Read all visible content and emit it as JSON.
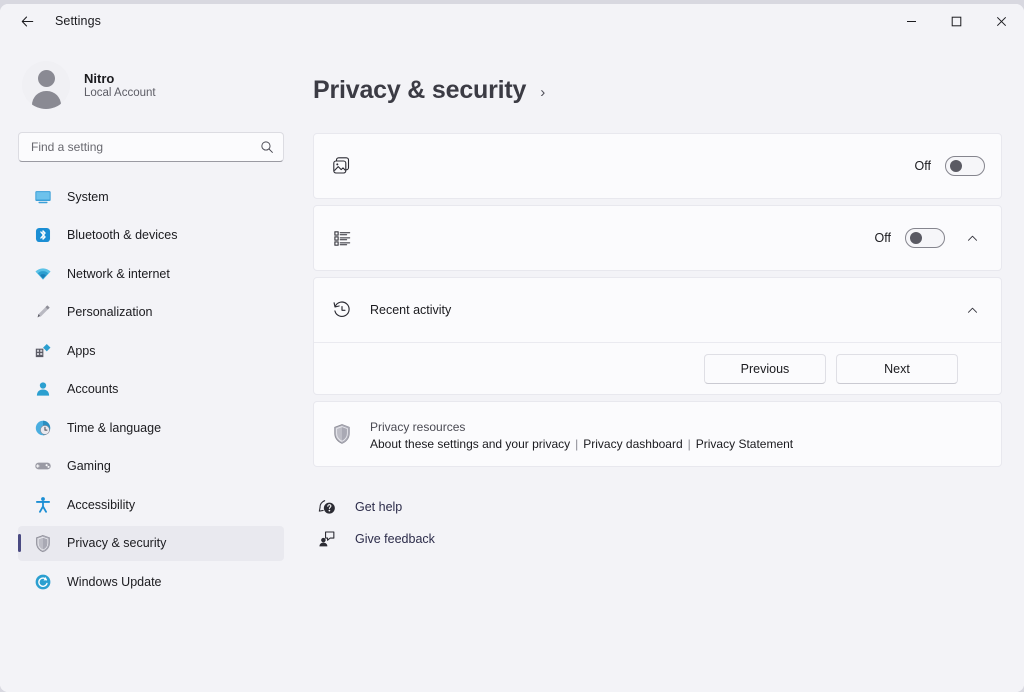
{
  "window": {
    "app_title": "Settings",
    "back_icon": "back-arrow-icon",
    "controls": {
      "minimize": "–",
      "maximize": "□",
      "close": "✕"
    }
  },
  "sidebar": {
    "profile": {
      "name": "Nitro",
      "account_type": "Local Account",
      "avatar_icon": "person-avatar-icon"
    },
    "search": {
      "placeholder": "Find a setting",
      "value": "",
      "icon": "search-icon"
    },
    "items": [
      {
        "label": "System",
        "icon": "system-icon",
        "selected": false
      },
      {
        "label": "Bluetooth & devices",
        "icon": "bluetooth-icon",
        "selected": false
      },
      {
        "label": "Network & internet",
        "icon": "network-wifi-icon",
        "selected": false
      },
      {
        "label": "Personalization",
        "icon": "paintbrush-icon",
        "selected": false
      },
      {
        "label": "Apps",
        "icon": "apps-icon",
        "selected": false
      },
      {
        "label": "Accounts",
        "icon": "accounts-icon",
        "selected": false
      },
      {
        "label": "Time & language",
        "icon": "clock-globe-icon",
        "selected": false
      },
      {
        "label": "Gaming",
        "icon": "gamepad-icon",
        "selected": false
      },
      {
        "label": "Accessibility",
        "icon": "accessibility-icon",
        "selected": false
      },
      {
        "label": "Privacy & security",
        "icon": "shield-icon",
        "selected": true
      },
      {
        "label": "Windows Update",
        "icon": "update-refresh-icon",
        "selected": false
      }
    ]
  },
  "main": {
    "page_title": "Privacy & security",
    "page_chevron": "›",
    "cards": [
      {
        "name": "photos-setting-card",
        "icon": "photos-image-icon",
        "title": "",
        "toggle_label": "Off",
        "toggle_state": "off",
        "has_expander": false
      },
      {
        "name": "list-setting-card",
        "icon": "bulleted-list-icon",
        "title": "",
        "toggle_label": "Off",
        "toggle_state": "off",
        "has_expander": true,
        "expander_icon": "chevron-up-icon"
      }
    ],
    "recent_activity": {
      "title": "Recent activity",
      "icon": "history-clock-icon",
      "expander_icon": "chevron-up-icon",
      "previous_label": "Previous",
      "next_label": "Next"
    },
    "privacy_resources": {
      "icon": "shield-icon",
      "title": "Privacy resources",
      "links": [
        "About these settings and your privacy",
        "Privacy dashboard",
        "Privacy Statement"
      ],
      "separator": "|"
    },
    "bottom_links": [
      {
        "label": "Get help",
        "icon": "help-question-icon"
      },
      {
        "label": "Give feedback",
        "icon": "feedback-person-icon"
      }
    ]
  },
  "colors": {
    "page_background": "#f3f3f7",
    "card_background": "#fbfbfd",
    "accent": "#4a4a82",
    "selected_row": "#e9e9ef",
    "text_primary": "#1b1b1f",
    "text_secondary": "#5d5d66"
  }
}
